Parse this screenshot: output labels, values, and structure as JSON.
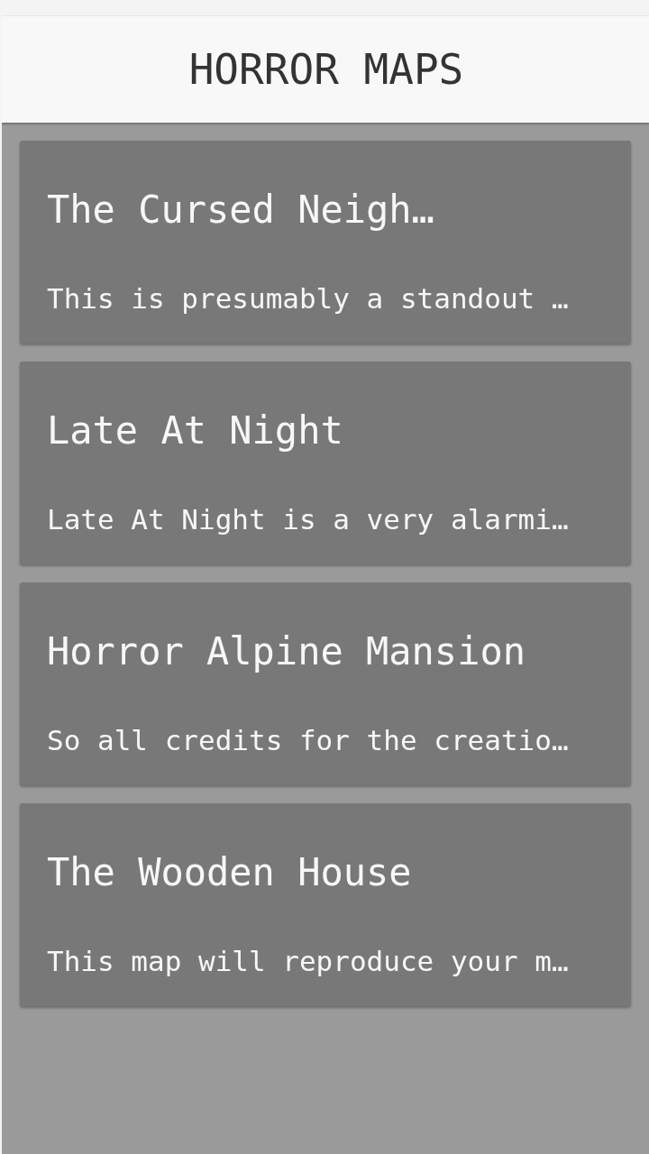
{
  "header": {
    "title": "HORROR MAPS"
  },
  "maps": [
    {
      "title": "The Cursed Neigh…",
      "description": "This is presumably a standout …"
    },
    {
      "title": "Late At Night",
      "description": "Late At Night is a very alarmi…"
    },
    {
      "title": "Horror Alpine Mansion",
      "description": "So all credits for the creatio…"
    },
    {
      "title": "The Wooden House",
      "description": "This map will reproduce your m…"
    }
  ]
}
